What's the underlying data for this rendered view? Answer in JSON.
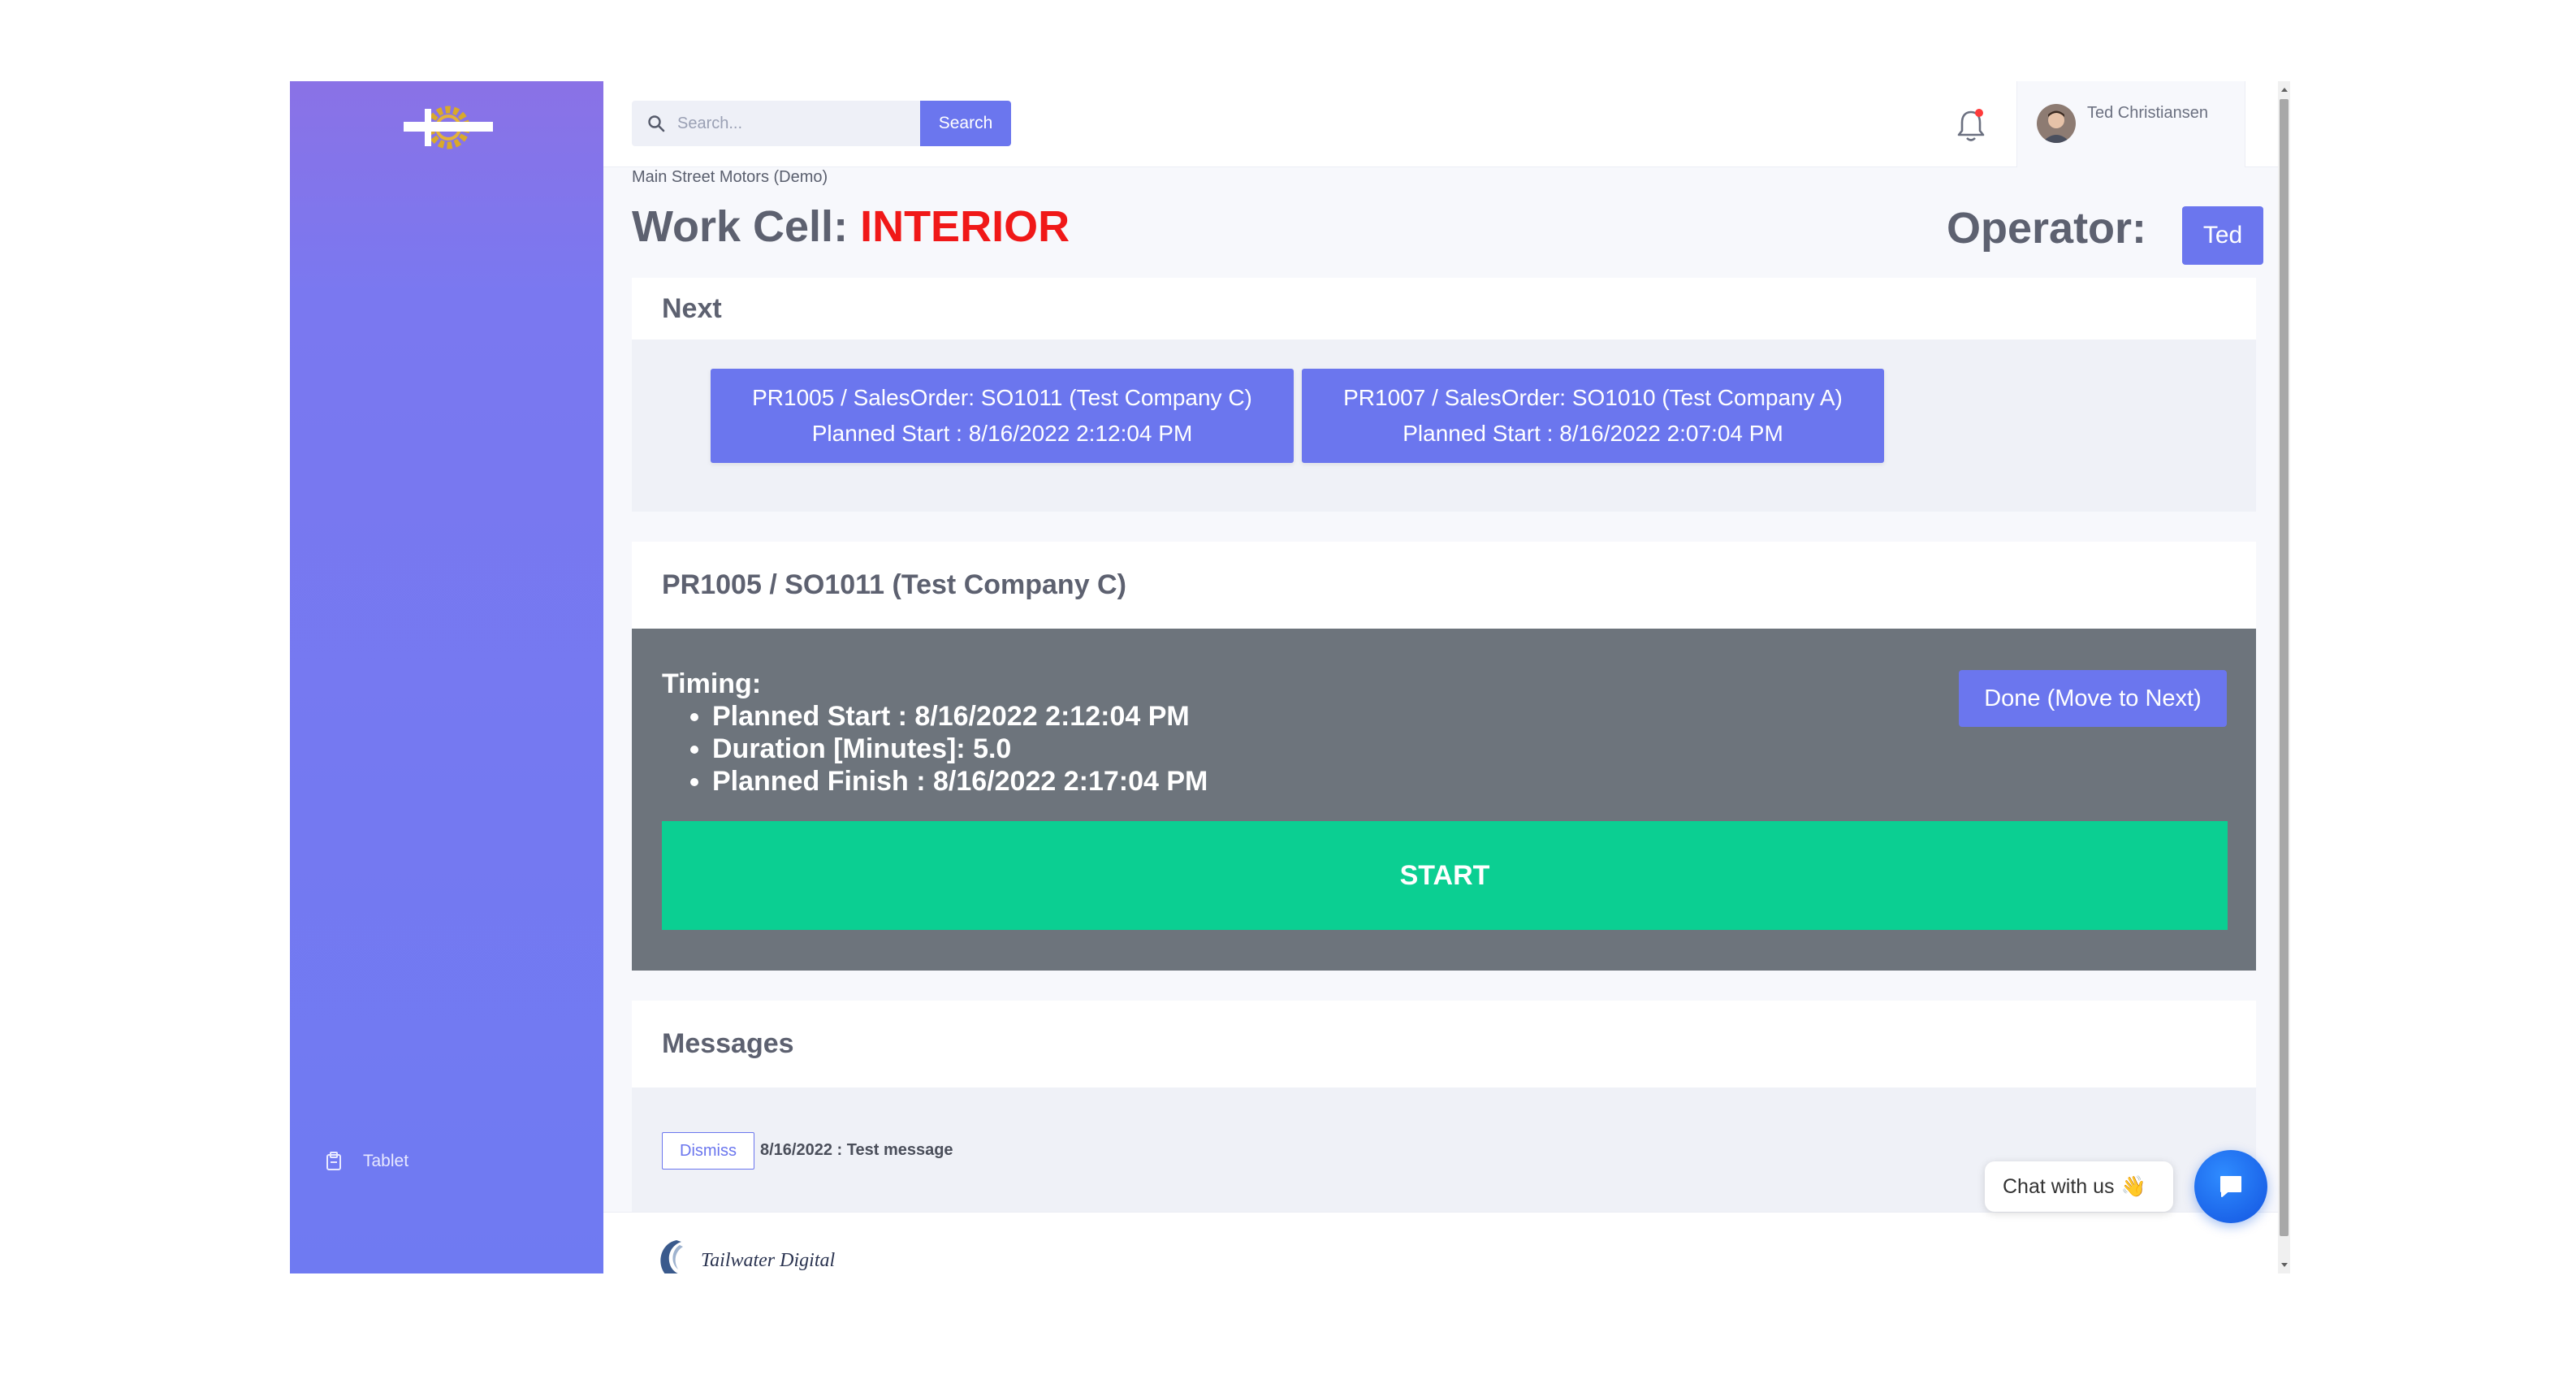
{
  "sidebar": {
    "items": [
      {
        "label": "Tablet",
        "icon": "clipboard-icon"
      }
    ]
  },
  "search": {
    "placeholder": "Search...",
    "button_label": "Search"
  },
  "header": {
    "user_name": "Ted Christiansen",
    "notification_dot_color": "#ff3b3b"
  },
  "breadcrumb": "Main Street Motors (Demo)",
  "work_cell": {
    "label": "Work Cell: ",
    "name": "INTERIOR",
    "name_color": "#f01818"
  },
  "operator": {
    "label": "Operator:",
    "name": "Ted"
  },
  "next": {
    "title": "Next",
    "items": [
      {
        "line1": "PR1005 / SalesOrder: SO1011 (Test Company C)",
        "line2": "Planned Start : 8/16/2022 2:12:04 PM"
      },
      {
        "line1": "PR1007 / SalesOrder: SO1010 (Test Company A)",
        "line2": "Planned Start : 8/16/2022 2:07:04 PM"
      }
    ]
  },
  "current_job": {
    "title": "PR1005 / SO1011 (Test Company C)",
    "timing_label": "Timing:",
    "timing_items": [
      "Planned Start : 8/16/2022 2:12:04 PM",
      "Duration [Minutes]: 5.0",
      "Planned Finish : 8/16/2022 2:17:04 PM"
    ],
    "done_label": "Done (Move to Next)",
    "start_label": "START"
  },
  "messages": {
    "title": "Messages",
    "items": [
      {
        "dismiss_label": "Dismiss",
        "text": "8/16/2022 : Test message"
      }
    ]
  },
  "chat": {
    "label": "Chat with us",
    "emoji": "👋"
  },
  "footer": {
    "logo_text": "Tailwater Digital"
  },
  "colors": {
    "accent": "#6b76ee",
    "start": "#0bcf92",
    "job_body": "#6d747c",
    "sidebar": "#7178f0"
  }
}
